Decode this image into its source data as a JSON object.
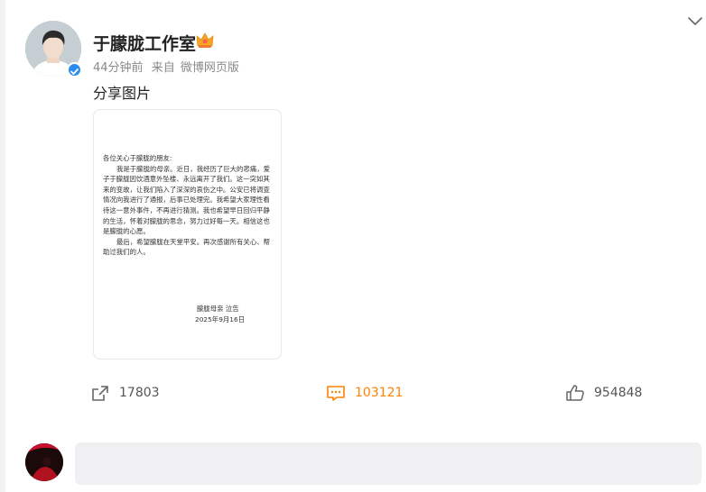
{
  "post": {
    "author": "于朦胧工作室",
    "time": "44分钟前",
    "source_prefix": "来自",
    "source": "微博网页版",
    "text": "分享图片"
  },
  "letter": {
    "greeting": "各位关心于朦胧的朋友:",
    "paragraph1": "我是于朦胧的母亲。近日，我经历了巨大的悲痛，爱子于朦胧因饮酒意外坠楼、永远离开了我们。这一突如其来的变故，让我们陷入了深深的哀伤之中。公安已将调查情况向我进行了通报，后事已处理完。我希望大家理性看待这一意外事件，不再进行猜测。我也希望早日回归平静的生活，怀着对朦胧的思念，努力过好每一天。相信这也是朦胧的心愿。",
    "paragraph2": "最后，希望朦胧在天堂平安。再次感谢所有关心、帮助过我们的人。",
    "signature": "朦胧母亲  泣告",
    "date": "2025年9月16日"
  },
  "actions": {
    "share_count": "17803",
    "comment_count": "103121",
    "like_count": "954848"
  },
  "icons": {
    "share": "share-icon",
    "comment": "comment-icon",
    "like": "thumbs-up-icon",
    "verified": "verified-badge-icon",
    "crown": "crown-icon",
    "menu": "chevron-down-icon"
  },
  "colors": {
    "accent": "#ff8200",
    "verified": "#2a8cf0"
  }
}
